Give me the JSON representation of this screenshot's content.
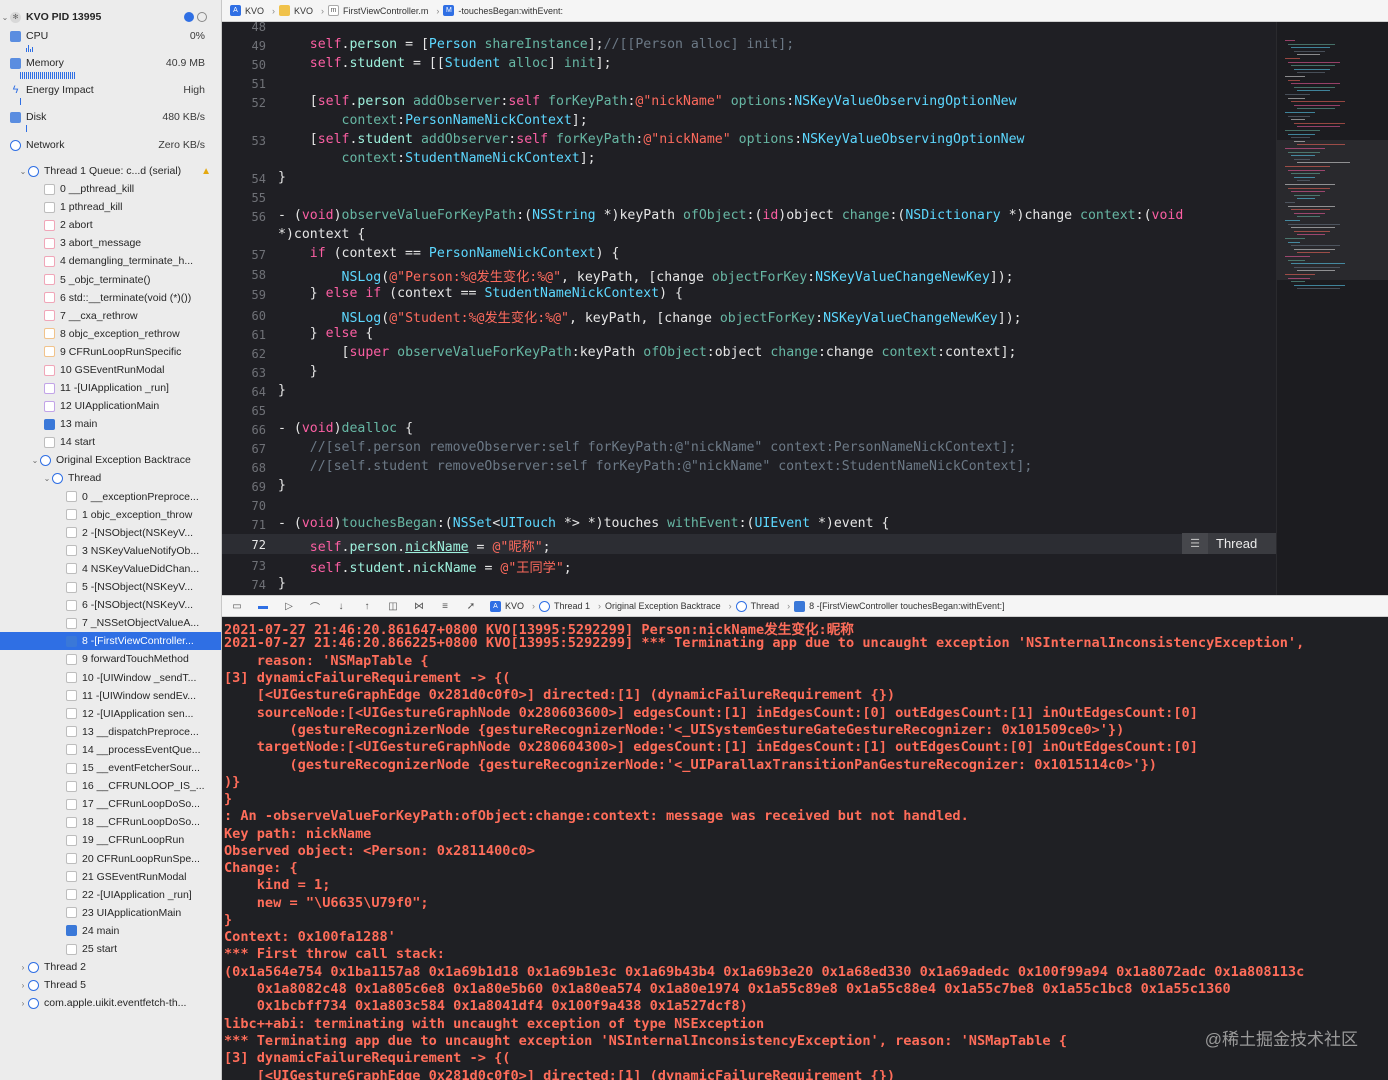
{
  "navigator": {
    "process": "KVO PID 13995",
    "gauges": [
      {
        "label": "CPU",
        "value": "0%"
      },
      {
        "label": "Memory",
        "value": "40.9 MB"
      },
      {
        "label": "Energy Impact",
        "value": "High"
      },
      {
        "label": "Disk",
        "value": "480 KB/s"
      },
      {
        "label": "Network",
        "value": "Zero KB/s"
      }
    ],
    "thread1": "Thread 1 Queue: c...d (serial)",
    "thread1_frames": [
      "0 __pthread_kill",
      "1 pthread_kill",
      "2 abort",
      "3 abort_message",
      "4 demangling_terminate_h...",
      "5 _objc_terminate()",
      "6 std::__terminate(void (*)())",
      "7 __cxa_rethrow",
      "8 objc_exception_rethrow",
      "9 CFRunLoopRunSpecific",
      "10 GSEventRunModal",
      "11 -[UIApplication _run]",
      "12 UIApplicationMain",
      "13 main",
      "14 start"
    ],
    "backtrace_group": "Original Exception Backtrace",
    "backtrace_thread": "Thread",
    "backtrace_frames": [
      "0 __exceptionPreproce...",
      "1 objc_exception_throw",
      "2 -[NSObject(NSKeyV...",
      "3 NSKeyValueNotifyOb...",
      "4 NSKeyValueDidChan...",
      "5 -[NSObject(NSKeyV...",
      "6 -[NSObject(NSKeyV...",
      "7 _NSSetObjectValueA...",
      "8 -[FirstViewController...",
      "9 forwardTouchMethod",
      "10 -[UIWindow _sendT...",
      "11 -[UIWindow sendEv...",
      "12 -[UIApplication sen...",
      "13 __dispatchPreproce...",
      "14 __processEventQue...",
      "15 __eventFetcherSour...",
      "16 __CFRUNLOOP_IS_...",
      "17 __CFRunLoopDoSo...",
      "18 __CFRunLoopDoSo...",
      "19 __CFRunLoopRun",
      "20 CFRunLoopRunSpe...",
      "21 GSEventRunModal",
      "22 -[UIApplication _run]",
      "23 UIApplicationMain",
      "24 main",
      "25 start"
    ],
    "other_threads": [
      "Thread 2",
      "Thread 5",
      "com.apple.uikit.eventfetch-th..."
    ]
  },
  "editor_breadcrumb": [
    "KVO",
    "KVO",
    "FirstViewController.m",
    "-touchesBegan:withEvent:"
  ],
  "editor": {
    "line_numbers": [
      "48",
      "49",
      "50",
      "51",
      "52",
      "",
      "53",
      "",
      "54",
      "55",
      "56",
      "",
      "57",
      "58",
      "59",
      "60",
      "61",
      "62",
      "63",
      "64",
      "65",
      "66",
      "67",
      "68",
      "69",
      "70",
      "71",
      "72",
      "73",
      "74"
    ],
    "thread_badge": "Thread"
  },
  "debug_breadcrumb": [
    "KVO",
    "Thread 1",
    "Original Exception Backtrace",
    "Thread",
    "8 -[FirstViewController touchesBegan:withEvent:]"
  ],
  "console": [
    "2021-07-27 21:46:20.861647+0800 KVO[13995:5292299] Person:nickName发生变化:昵称",
    "2021-07-27 21:46:20.866225+0800 KVO[13995:5292299] *** Terminating app due to uncaught exception 'NSInternalInconsistencyException',",
    "    reason: 'NSMapTable {",
    "[3] dynamicFailureRequirement -> {(",
    "    [<UIGestureGraphEdge 0x281d0c0f0>] directed:[1] (dynamicFailureRequirement {})",
    "    sourceNode:[<UIGestureGraphNode 0x280603600>] edgesCount:[1] inEdgesCount:[0] outEdgesCount:[1] inOutEdgesCount:[0]",
    "        (gestureRecognizerNode {gestureRecognizerNode:'<_UISystemGestureGateGestureRecognizer: 0x101509ce0>'})",
    "    targetNode:[<UIGestureGraphNode 0x280604300>] edgesCount:[1] inEdgesCount:[1] outEdgesCount:[0] inOutEdgesCount:[0]",
    "        (gestureRecognizerNode {gestureRecognizerNode:'<_UIParallaxTransitionPanGestureRecognizer: 0x1015114c0>'})",
    ")}",
    "}",
    ": An -observeValueForKeyPath:ofObject:change:context: message was received but not handled.",
    "Key path: nickName",
    "Observed object: <Person: 0x2811400c0>",
    "Change: {",
    "    kind = 1;",
    "    new = \"\\U6635\\U79f0\";",
    "}",
    "Context: 0x100fa1288'",
    "*** First throw call stack:",
    "(0x1a564e754 0x1ba1157a8 0x1a69b1d18 0x1a69b1e3c 0x1a69b43b4 0x1a69b3e20 0x1a68ed330 0x1a69adedc 0x100f99a94 0x1a8072adc 0x1a808113c",
    "    0x1a8082c48 0x1a805c6e8 0x1a80e5b60 0x1a80ea574 0x1a80e1974 0x1a55c89e8 0x1a55c88e4 0x1a55c7be8 0x1a55c1bc8 0x1a55c1360",
    "    0x1bcbff734 0x1a803c584 0x1a8041df4 0x100f9a438 0x1a527dcf8)",
    "libc++abi: terminating with uncaught exception of type NSException",
    "*** Terminating app due to uncaught exception 'NSInternalInconsistencyException', reason: 'NSMapTable {",
    "[3] dynamicFailureRequirement -> {(",
    "    [<UIGestureGraphEdge 0x281d0c0f0>] directed:[1] (dynamicFailureRequirement {})"
  ],
  "watermark": "@稀土掘金技术社区",
  "colors": {
    "accent": "#2f6fe4",
    "console_text": "#ff6d5a",
    "editor_bg": "#1f1f24"
  }
}
